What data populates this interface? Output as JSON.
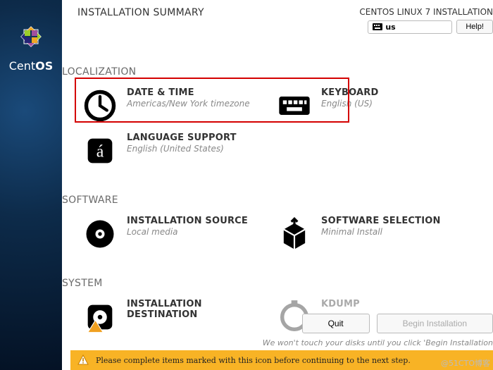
{
  "brand": {
    "part1": "Cent",
    "part2": "OS"
  },
  "header": {
    "title": "INSTALLATION SUMMARY",
    "subtitle": "CENTOS LINUX 7 INSTALLATION",
    "keyboard_layout": "us",
    "help_label": "Help!"
  },
  "sections": {
    "localization": {
      "heading": "LOCALIZATION"
    },
    "software": {
      "heading": "SOFTWARE"
    },
    "system": {
      "heading": "SYSTEM"
    }
  },
  "spokes": {
    "date_time": {
      "title": "DATE & TIME",
      "status": "Americas/New York timezone"
    },
    "keyboard": {
      "title": "KEYBOARD",
      "status": "English (US)"
    },
    "language": {
      "title": "LANGUAGE SUPPORT",
      "status": "English (United States)"
    },
    "install_source": {
      "title": "INSTALLATION SOURCE",
      "status": "Local media"
    },
    "software_sel": {
      "title": "SOFTWARE SELECTION",
      "status": "Minimal Install"
    },
    "install_dest": {
      "title": "INSTALLATION DESTINATION",
      "status": " "
    },
    "kdump": {
      "title": "KDUMP",
      "status": " "
    }
  },
  "footer": {
    "quit_label": "Quit",
    "begin_label": "Begin Installation",
    "hint": "We won't touch your disks until you click 'Begin Installation"
  },
  "warning": {
    "text": "Please complete items marked with this icon before continuing to the next step."
  },
  "watermark": "@51CTO博客"
}
